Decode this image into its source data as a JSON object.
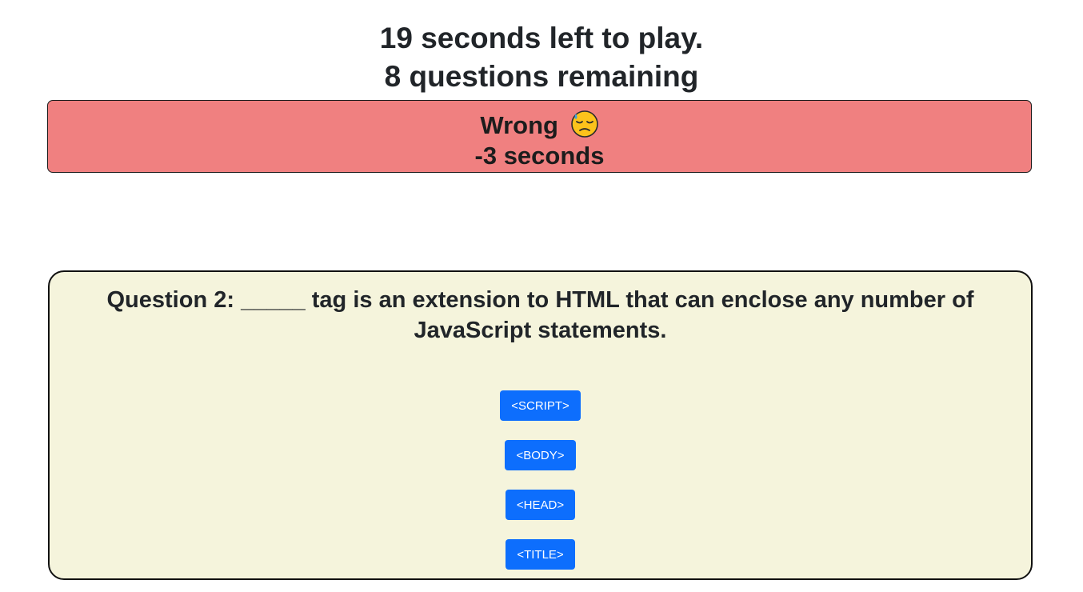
{
  "status": {
    "time_left": "19 seconds left to play.",
    "questions_remaining": "8 questions remaining"
  },
  "feedback": {
    "result": "Wrong",
    "emoji_icon": "downcast-face-with-sweat-emoji",
    "penalty": "-3 seconds",
    "background_color": "#f08080"
  },
  "question": {
    "text": "Question 2: _____ tag is an extension to HTML that can enclose any number of JavaScript statements.",
    "answers": [
      {
        "label": "<SCRIPT>"
      },
      {
        "label": "<BODY>"
      },
      {
        "label": "<HEAD>"
      },
      {
        "label": "<TITLE>"
      }
    ],
    "card_color": "#f5f4dc",
    "button_color": "#0d6efd"
  }
}
